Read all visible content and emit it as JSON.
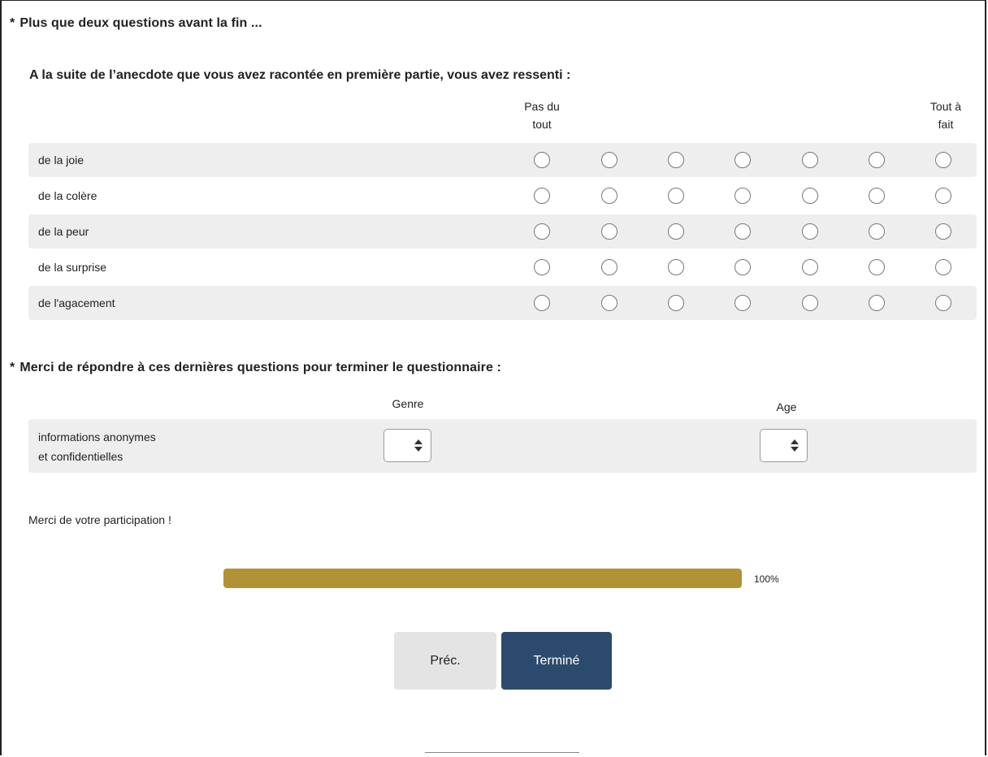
{
  "q1": {
    "title": "Plus que deux questions avant la fin ...",
    "subtitle": "A la suite de l’anecdote que vous avez racontée en première partie, vous avez ressenti :",
    "scale_low_line1": "Pas du",
    "scale_low_line2": "tout",
    "scale_high_line1": "Tout à",
    "scale_high_line2": "fait",
    "rows": [
      {
        "label": "de la joie"
      },
      {
        "label": "de la colère"
      },
      {
        "label": "de la peur"
      },
      {
        "label": "de la surprise"
      },
      {
        "label": "de l'agacement"
      }
    ]
  },
  "q2": {
    "title": "Merci de répondre à ces dernières questions pour terminer le questionnaire :",
    "col_genre": "Genre",
    "col_age": "Age",
    "row_label_line1": "informations anonymes",
    "row_label_line2": "et confidentielles"
  },
  "required_marker": "*",
  "thanks": "Merci de votre participation !",
  "progress": {
    "value_percent": 100,
    "label": "100%",
    "color": "#b19336"
  },
  "buttons": {
    "prev": "Préc.",
    "done": "Terminé",
    "done_color": "#2c4a6e"
  }
}
